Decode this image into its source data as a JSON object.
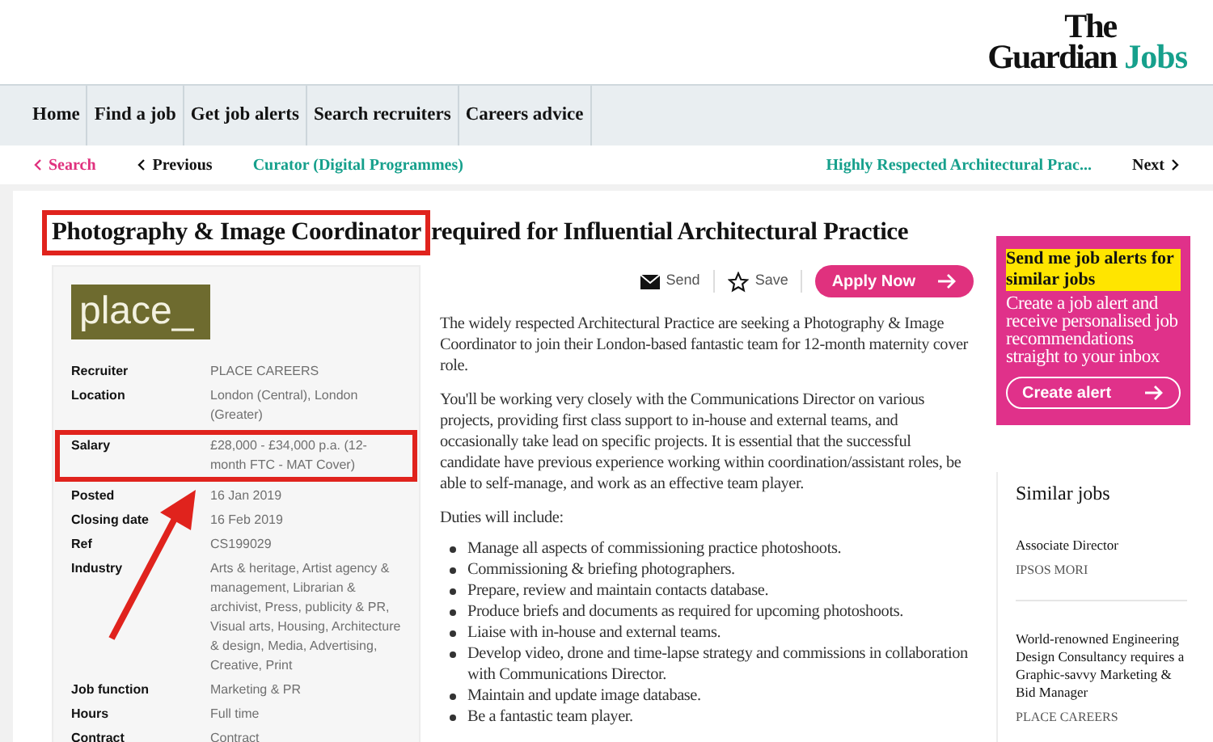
{
  "logo": {
    "line1": "The",
    "line2": "Guardian",
    "accent": "Jobs"
  },
  "nav": [
    {
      "label": "Home"
    },
    {
      "label": "Find a job"
    },
    {
      "label": "Get job alerts"
    },
    {
      "label": "Search recruiters"
    },
    {
      "label": "Careers advice"
    }
  ],
  "breadcrumb": {
    "back": "Search",
    "previous": "Previous",
    "previous_title": "Curator (Digital Programmes)",
    "next_title": "Highly Respected Architectural Prac...",
    "next": "Next"
  },
  "title": [
    {
      "text": "Photography & Image Coordinator",
      "highlighted": true
    },
    {
      "text": "required for Influential Architectural Practice",
      "highlighted": false
    }
  ],
  "recruiter_logo": "place_",
  "details": [
    {
      "label": "Recruiter",
      "value": "PLACE CAREERS",
      "highlighted": false
    },
    {
      "label": "Location",
      "value": "London (Central), London (Greater)",
      "highlighted": false
    },
    {
      "label": "Salary",
      "value": "£28,000 - £34,000 p.a. (12-month FTC - MAT Cover)",
      "highlighted": true
    },
    {
      "label": "Posted",
      "value": "16 Jan 2019",
      "highlighted": false
    },
    {
      "label": "Closing date",
      "value": "16 Feb 2019",
      "highlighted": false
    },
    {
      "label": "Ref",
      "value": "CS199029",
      "highlighted": false
    },
    {
      "label": "Industry",
      "value": "Arts & heritage, Artist agency & management, Librarian & archivist, Press, publicity & PR, Visual arts, Housing, Architecture & design, Media, Advertising, Creative, Print",
      "highlighted": false
    },
    {
      "label": "Job function",
      "value": "Marketing & PR",
      "highlighted": false
    },
    {
      "label": "Hours",
      "value": "Full time",
      "highlighted": false
    },
    {
      "label": "Contract",
      "value": "Contract",
      "highlighted": false
    }
  ],
  "annotation_arrow": true,
  "actions": {
    "send": "Send",
    "save": "Save",
    "apply": "Apply Now"
  },
  "description": [
    "The widely respected Architectural Practice are seeking a Photography & Image Coordinator to join their London-based fantastic team for 12-month maternity cover role.",
    "You'll be working very closely with the Communications Director on various projects, providing first class support to in-house and external teams, and occasionally take lead on specific projects. It is essential that the successful candidate have previous experience working within coordination/assistant roles, be able to self-manage, and work as an effective team player.",
    "Duties will include:"
  ],
  "duties": [
    "Manage all aspects of commissioning practice photoshoots.",
    "Commissioning & briefing photographers.",
    "Prepare, review and maintain contacts database.",
    "Produce briefs and documents as required for upcoming photoshoots.",
    "Liaise with in-house and external teams.",
    "Develop video, drone and time-lapse strategy and commissions in collaboration with Communications Director.",
    "Maintain and update image database.",
    "Be a fantastic team player."
  ],
  "alert": {
    "heading": "Send me job alerts for similar jobs",
    "body": "Create a job alert and receive personalised job recommendations straight to your inbox",
    "button": "Create alert"
  },
  "similar": {
    "title": "Similar jobs",
    "items": [
      {
        "title": "Associate Director",
        "company": "IPSOS MORI"
      },
      {
        "title": "World-renowned Engineering Design Consultancy requires a Graphic-savvy Marketing & Bid Manager",
        "company": "PLACE CAREERS"
      }
    ]
  }
}
